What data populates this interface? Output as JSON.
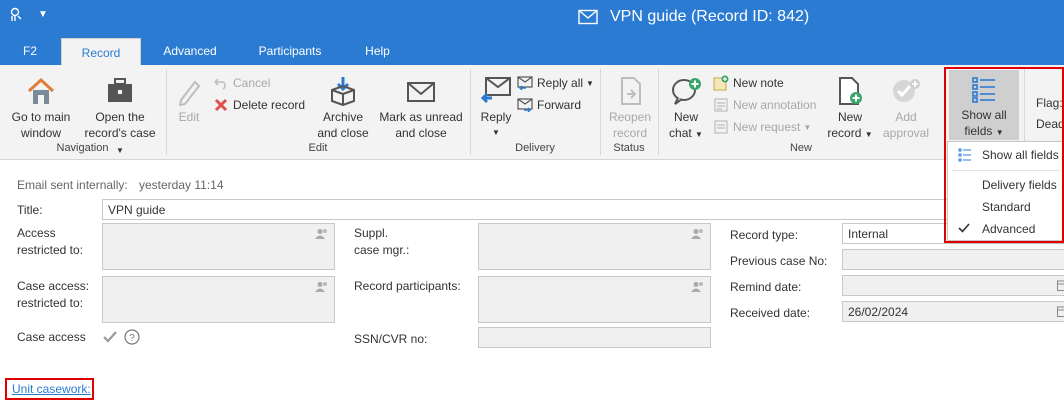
{
  "window": {
    "title": "VPN guide (Record ID: 842)"
  },
  "tabs": [
    {
      "label": "F2"
    },
    {
      "label": "Record"
    },
    {
      "label": "Advanced"
    },
    {
      "label": "Participants"
    },
    {
      "label": "Help"
    }
  ],
  "ribbon": {
    "navigation": {
      "group_label": "Navigation",
      "go_main": [
        "Go to main",
        "window"
      ],
      "open_case": [
        "Open the",
        "record's case"
      ]
    },
    "edit": {
      "group_label": "Edit",
      "edit": "Edit",
      "cancel": "Cancel",
      "delete": "Delete record",
      "archive": [
        "Archive",
        "and close"
      ],
      "mark_unread": [
        "Mark as unread",
        "and close"
      ]
    },
    "delivery": {
      "group_label": "Delivery",
      "reply": "Reply",
      "reply_all": "Reply all",
      "forward": "Forward"
    },
    "status": {
      "group_label": "Status",
      "reopen": [
        "Reopen",
        "record"
      ]
    },
    "new": {
      "group_label": "New",
      "new_chat": [
        "New",
        "chat"
      ],
      "new_note": "New note",
      "new_annotation": "New annotation",
      "new_request": "New request",
      "new_record": [
        "New",
        "record"
      ],
      "add_approval": [
        "Add",
        "approval"
      ]
    },
    "fields": {
      "show_all": [
        "Show all",
        "fields"
      ]
    },
    "flag_cut": "Flag:",
    "dead_cut": "Dead"
  },
  "dropdown": {
    "items": [
      "Show all fields",
      "Delivery fields",
      "Standard",
      "Advanced"
    ],
    "checked": "Advanced"
  },
  "form": {
    "sent_label": "Email sent internally:",
    "sent_value": "yesterday 11:14",
    "title_label": "Title:",
    "title_value": "VPN guide",
    "access_restricted": [
      "Access",
      "restricted to:"
    ],
    "case_access_restricted": [
      "Case access:",
      "restricted to:"
    ],
    "case_access": "Case access",
    "suppl": [
      "Suppl.",
      "case mgr.:"
    ],
    "record_participants": "Record participants:",
    "ssn": "SSN/CVR no:",
    "record_type_label": "Record type:",
    "record_type_value": "Internal",
    "previous_case_label": "Previous case No:",
    "remind_date_label": "Remind date:",
    "received_date_label": "Received date:",
    "received_date_value": "26/02/2024",
    "unit_casework": "Unit casework:"
  },
  "colors": {
    "accent": "#2b7bd3",
    "highlight": "#e00000"
  }
}
